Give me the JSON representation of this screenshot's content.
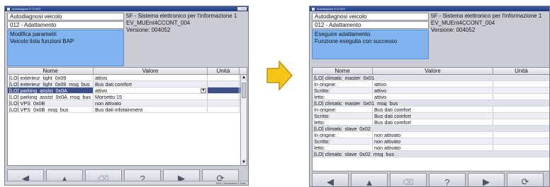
{
  "left": {
    "window_title": "Autodiagnosi 9.12.003",
    "header": {
      "boxes": [
        "Autodiagnosi veicolo",
        "012 - Adattamento"
      ],
      "selected_lines": [
        "Modifica parametri",
        "Veicolo lista funzioni BAP"
      ],
      "info": [
        "5F - Sistema elettronico per l'informazione 1",
        "EV_MUEnt4CCONT_004",
        "Versione: 004052"
      ]
    },
    "table": {
      "columns": [
        "Nome",
        "Valore",
        "Unità"
      ],
      "rows": [
        {
          "name": "[LO] exterieur_light_0x09",
          "value": "attivo",
          "unit": ""
        },
        {
          "name": "[LO] exterieur_light_0x09_msg_bus",
          "value": "Bus dati comfort",
          "unit": ""
        },
        {
          "name": "[LO] parking_assist_0x0A",
          "value": "attivo",
          "unit": "",
          "selected": true
        },
        {
          "name": "[LO] parking_assist_0x0A_msg_bus",
          "value": "Morsetto 15",
          "unit": ""
        },
        {
          "name": "[LO] VPS_0x0B",
          "value": "non attivato",
          "unit": ""
        },
        {
          "name": "[LO] VPS_0x0B_msg_bus",
          "value": "Bus dati infotainment",
          "unit": ""
        }
      ]
    },
    "status": "16/5   4   Simulazione   8   Trace"
  },
  "right": {
    "window_title": "Autodiagnosi 9.12.003",
    "header": {
      "boxes": [
        "Autodiagnosi veicolo",
        "012 - Adattamento"
      ],
      "selected_lines": [
        "Eseguire adattamento",
        "Funzione eseguita con successo"
      ],
      "info": [
        "5F - Sistema elettronico per l'informazione 1",
        "EV_MUEnt4CCONT_004",
        "Versione: 004052"
      ]
    },
    "table": {
      "columns": [
        "Nome",
        "Valore",
        "Unità"
      ],
      "groups": [
        {
          "title": "[LO] climatic_master_0x01",
          "rows": [
            {
              "label": "In origine:",
              "value": "attivo"
            },
            {
              "label": "Scritto:",
              "value": "attivo"
            },
            {
              "label": "letto:",
              "value": "attivo"
            }
          ]
        },
        {
          "title": "[LO] climatic_master_0x01_msg_bus",
          "rows": [
            {
              "label": "In origine:",
              "value": "Bus dati comfort"
            },
            {
              "label": "Scritto:",
              "value": "Bus dati comfort"
            },
            {
              "label": "letto:",
              "value": "Bus dati comfort"
            }
          ]
        },
        {
          "title": "[LO] climatic_slave_0x02",
          "rows": [
            {
              "label": "In origine:",
              "value": "non attivato"
            },
            {
              "label": "Scritto:",
              "value": "non attivato"
            },
            {
              "label": "letto:",
              "value": "non attivato"
            }
          ]
        },
        {
          "title": "[LO] climatic_slave_0x02_msg_bus",
          "rows": []
        }
      ]
    }
  },
  "toolbar": {
    "buttons": [
      {
        "name": "back",
        "glyph": "◀",
        "enabled": true
      },
      {
        "name": "up",
        "glyph": "▲",
        "enabled": true
      },
      {
        "name": "eraser",
        "glyph": "⌫",
        "enabled": false
      },
      {
        "name": "help",
        "glyph": "?",
        "enabled": true
      },
      {
        "name": "forward",
        "glyph": "▶",
        "enabled": true
      },
      {
        "name": "refresh",
        "glyph": "⟳",
        "enabled": true
      }
    ]
  },
  "colors": {
    "arrow": "#f5c518",
    "selection": "#7fb4f0",
    "selected_row": "#3d4f86"
  }
}
